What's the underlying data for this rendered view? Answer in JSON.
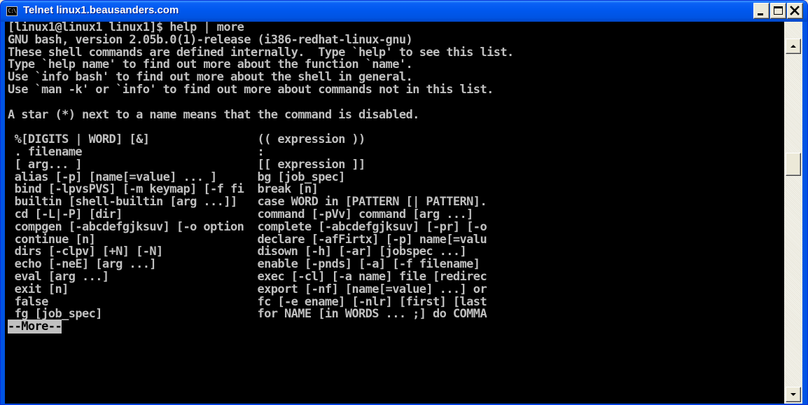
{
  "window": {
    "title": "Telnet linux1.beausanders.com",
    "icon": "console-icon",
    "icon_text": "C:\\",
    "colors": {
      "titlebar": "#0054E3",
      "terminal_bg": "#000000",
      "terminal_fg": "#C0C0C0"
    }
  },
  "controls": {
    "minimize": "minimize-icon",
    "maximize": "maximize-icon",
    "close": "close-icon"
  },
  "terminal": {
    "lines": [
      "[linux1@linux1 linux1]$ help | more",
      "GNU bash, version 2.05b.0(1)-release (i386-redhat-linux-gnu)",
      "These shell commands are defined internally.  Type `help' to see this list.",
      "Type `help name' to find out more about the function `name'.",
      "Use `info bash' to find out more about the shell in general.",
      "Use `man -k' or `info' to find out more about commands not in this list.",
      "",
      "A star (*) next to a name means that the command is disabled.",
      "",
      " %[DIGITS | WORD] [&]                (( expression ))",
      " . filename                          :",
      " [ arg... ]                          [[ expression ]]",
      " alias [-p] [name[=value] ... ]      bg [job_spec]",
      " bind [-lpvsPVS] [-m keymap] [-f fi  break [n]",
      " builtin [shell-builtin [arg ...]]   case WORD in [PATTERN [| PATTERN].",
      " cd [-L|-P] [dir]                    command [-pVv] command [arg ...]",
      " compgen [-abcdefgjksuv] [-o option  complete [-abcdefgjksuv] [-pr] [-o",
      " continue [n]                        declare [-afFirtx] [-p] name[=valu",
      " dirs [-clpv] [+N] [-N]              disown [-h] [-ar] [jobspec ...]",
      " echo [-neE] [arg ...]               enable [-pnds] [-a] [-f filename]",
      " eval [arg ...]                      exec [-cl] [-a name] file [redirec",
      " exit [n]                            export [-nf] [name[=value] ...] or",
      " false                               fc [-e ename] [-nlr] [first] [last",
      " fg [job_spec]                       for NAME [in WORDS ... ;] do COMMA"
    ],
    "more_prompt": "--More--"
  },
  "scrollbar": {
    "up_icon": "arrow-up-icon",
    "down_icon": "arrow-down-icon"
  }
}
